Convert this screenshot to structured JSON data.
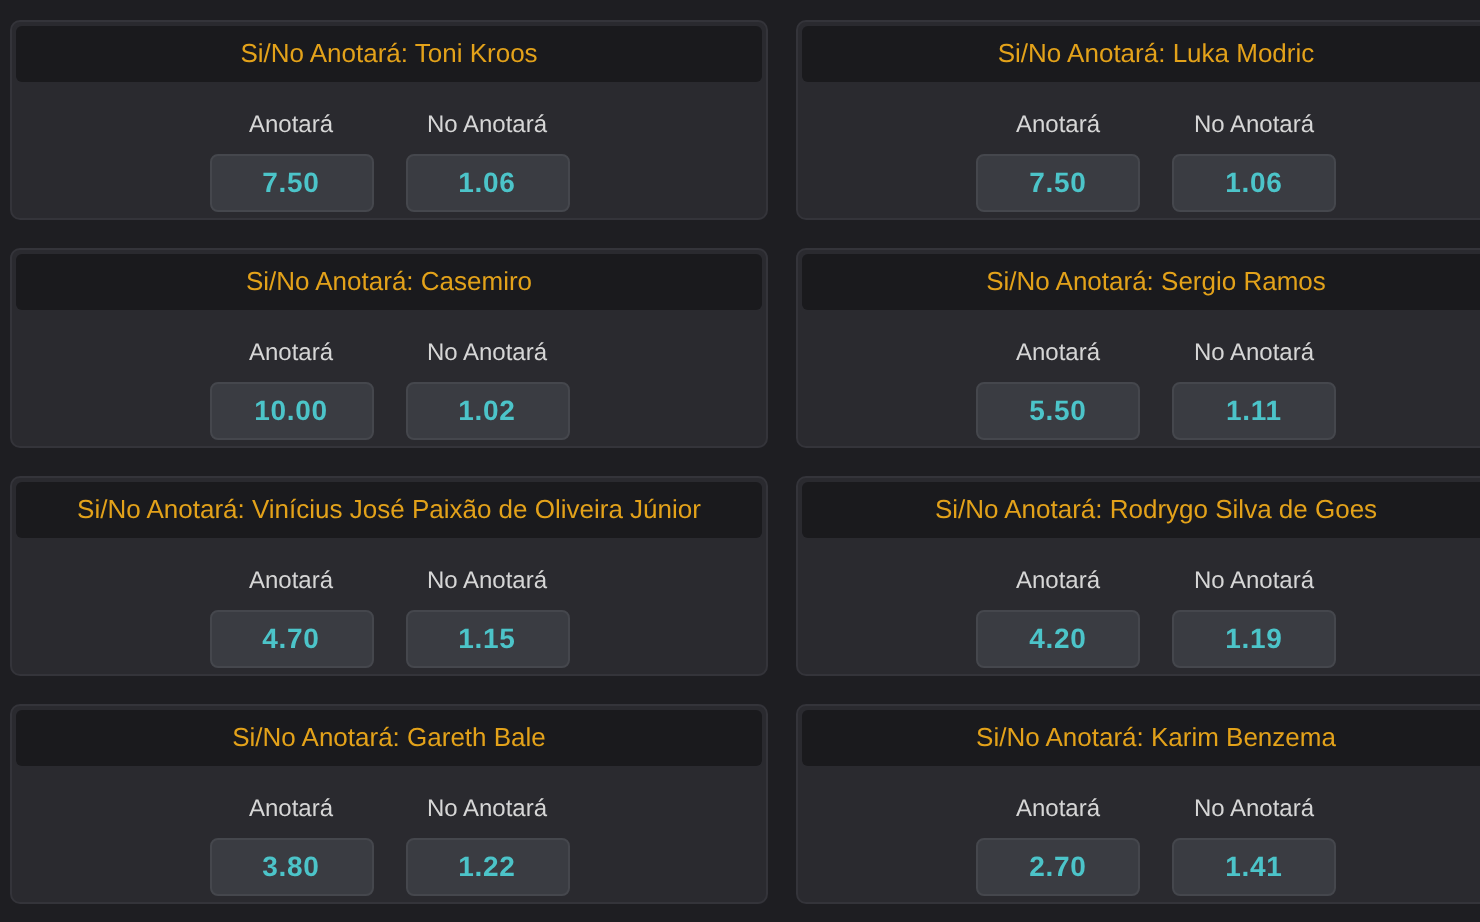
{
  "markets": [
    {
      "title": "Si/No Anotará: Toni Kroos",
      "options": [
        {
          "label": "Anotará",
          "odds": "7.50"
        },
        {
          "label": "No Anotará",
          "odds": "1.06"
        }
      ]
    },
    {
      "title": "Si/No Anotará: Luka Modric",
      "options": [
        {
          "label": "Anotará",
          "odds": "7.50"
        },
        {
          "label": "No Anotará",
          "odds": "1.06"
        }
      ]
    },
    {
      "title": "Si/No Anotará: Casemiro",
      "options": [
        {
          "label": "Anotará",
          "odds": "10.00"
        },
        {
          "label": "No Anotará",
          "odds": "1.02"
        }
      ]
    },
    {
      "title": "Si/No Anotará: Sergio Ramos",
      "options": [
        {
          "label": "Anotará",
          "odds": "5.50"
        },
        {
          "label": "No Anotará",
          "odds": "1.11"
        }
      ]
    },
    {
      "title": "Si/No Anotará: Vinícius José Paixão de Oliveira Júnior",
      "options": [
        {
          "label": "Anotará",
          "odds": "4.70"
        },
        {
          "label": "No Anotará",
          "odds": "1.15"
        }
      ]
    },
    {
      "title": "Si/No Anotará: Rodrygo Silva de Goes",
      "options": [
        {
          "label": "Anotará",
          "odds": "4.20"
        },
        {
          "label": "No Anotará",
          "odds": "1.19"
        }
      ]
    },
    {
      "title": "Si/No Anotará: Gareth Bale",
      "options": [
        {
          "label": "Anotará",
          "odds": "3.80"
        },
        {
          "label": "No Anotará",
          "odds": "1.22"
        }
      ]
    },
    {
      "title": "Si/No Anotará: Karim Benzema",
      "options": [
        {
          "label": "Anotará",
          "odds": "2.70"
        },
        {
          "label": "No Anotará",
          "odds": "1.41"
        }
      ]
    }
  ]
}
